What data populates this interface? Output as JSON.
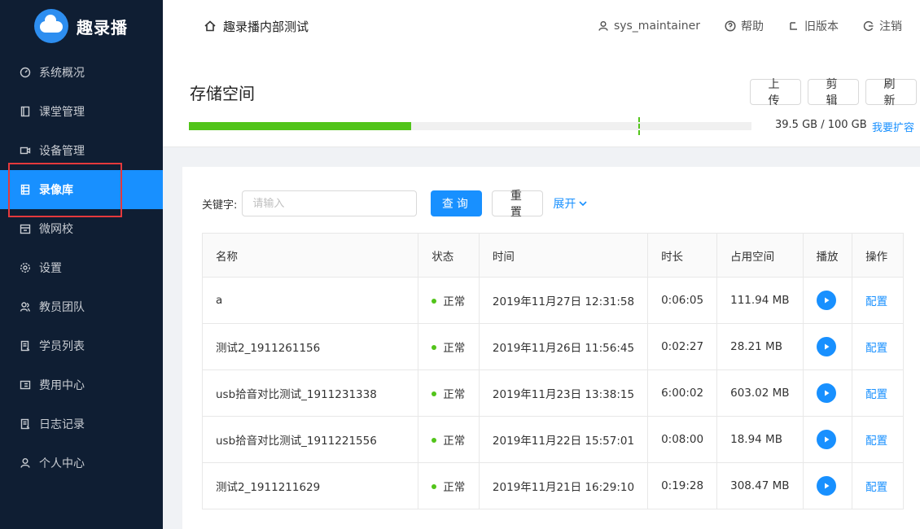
{
  "brand": {
    "title": "趣录播"
  },
  "sidebar": {
    "items": [
      {
        "label": "系统概况",
        "icon": "dashboard-icon"
      },
      {
        "label": "课堂管理",
        "icon": "book-icon"
      },
      {
        "label": "设备管理",
        "icon": "camera-icon"
      },
      {
        "label": "录像库",
        "icon": "video-library-icon",
        "active": true
      },
      {
        "label": "微网校",
        "icon": "school-icon"
      },
      {
        "label": "设置",
        "icon": "gear-icon"
      },
      {
        "label": "教员团队",
        "icon": "team-icon"
      },
      {
        "label": "学员列表",
        "icon": "student-list-icon"
      },
      {
        "label": "费用中心",
        "icon": "billing-icon"
      },
      {
        "label": "日志记录",
        "icon": "log-icon"
      },
      {
        "label": "个人中心",
        "icon": "user-icon"
      }
    ]
  },
  "header": {
    "title": "趣录播内部测试",
    "user": "sys_maintainer",
    "help": "帮助",
    "old_version": "旧版本",
    "logout": "注销"
  },
  "storage": {
    "title": "存储空间",
    "upload_label": "上传",
    "edit_label": "剪辑",
    "refresh_label": "刷新",
    "used_fraction": 0.395,
    "usage_text": "39.5 GB / 100 GB",
    "expand_label": "我要扩容"
  },
  "search": {
    "label": "关键字:",
    "placeholder": "请输入",
    "query_label": "查询",
    "reset_label": "重置",
    "expand_label": "展开"
  },
  "table": {
    "headers": [
      "名称",
      "状态",
      "时间",
      "时长",
      "占用空间",
      "播放",
      "操作"
    ],
    "rows": [
      {
        "name": "a",
        "status": "正常",
        "time": "2019年11月27日 12:31:58",
        "duration": "0:06:05",
        "size": "111.94 MB",
        "action": "配置"
      },
      {
        "name": "测试2_1911261156",
        "status": "正常",
        "time": "2019年11月26日 11:56:45",
        "duration": "0:02:27",
        "size": "28.21 MB",
        "action": "配置"
      },
      {
        "name": "usb拾音对比测试_1911231338",
        "status": "正常",
        "time": "2019年11月23日 13:38:15",
        "duration": "6:00:02",
        "size": "603.02 MB",
        "action": "配置"
      },
      {
        "name": "usb拾音对比测试_1911221556",
        "status": "正常",
        "time": "2019年11月22日 15:57:01",
        "duration": "0:08:00",
        "size": "18.94 MB",
        "action": "配置"
      },
      {
        "name": "测试2_1911211629",
        "status": "正常",
        "time": "2019年11月21日 16:29:10",
        "duration": "0:19:28",
        "size": "308.47 MB",
        "action": "配置"
      }
    ]
  }
}
